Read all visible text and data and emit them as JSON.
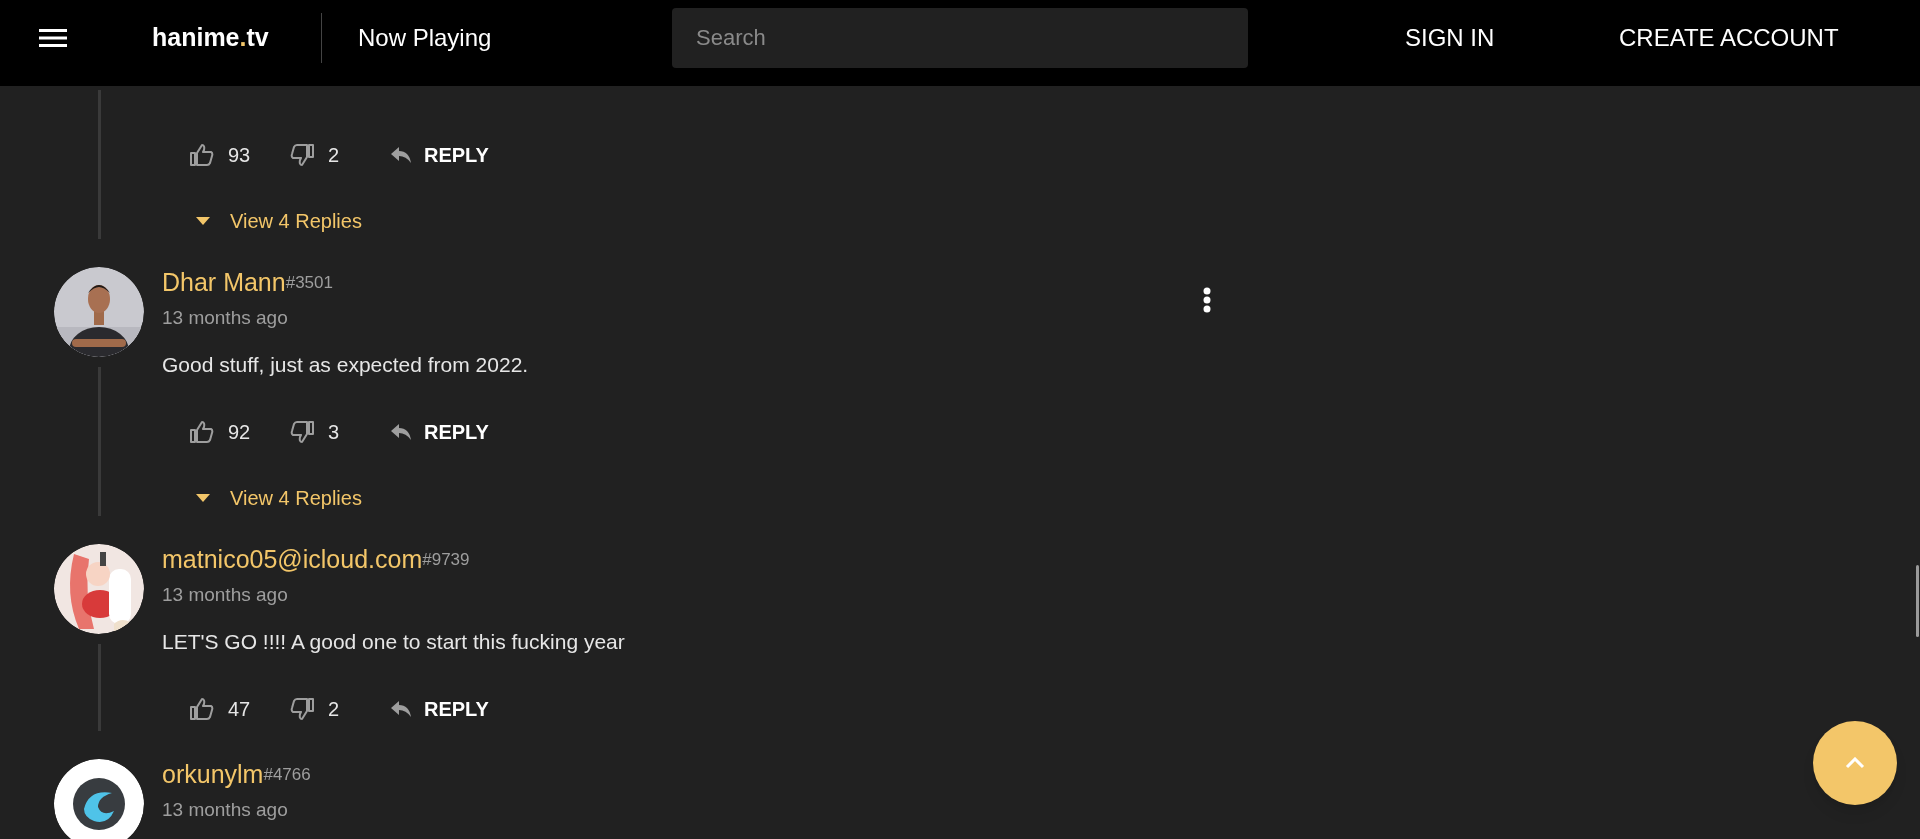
{
  "header": {
    "brand_name": "hanime",
    "brand_dot": ".",
    "brand_suffix": "tv",
    "section": "Now Playing",
    "search": {
      "placeholder": "Search"
    },
    "sign_in": "SIGN IN",
    "create_account": "CREATE ACCOUNT"
  },
  "comments": [
    {
      "likes": "93",
      "dislikes": "2",
      "reply": "REPLY",
      "view_replies": "View 4 Replies"
    },
    {
      "user": "Dhar Mann",
      "tag": "#3501",
      "time": "13 months ago",
      "text": "Good stuff, just as expected from 2022.",
      "likes": "92",
      "dislikes": "3",
      "reply": "REPLY",
      "view_replies": "View 4 Replies",
      "menu_visible": true
    },
    {
      "user": "matnico05@icloud.com",
      "tag": "#9739",
      "time": "13 months ago",
      "text": "LET'S GO !!!! A good one to start this fucking year",
      "likes": "47",
      "dislikes": "2",
      "reply": "REPLY"
    },
    {
      "user": "orkunylm",
      "tag": "#4766",
      "time": "13 months ago"
    }
  ]
}
